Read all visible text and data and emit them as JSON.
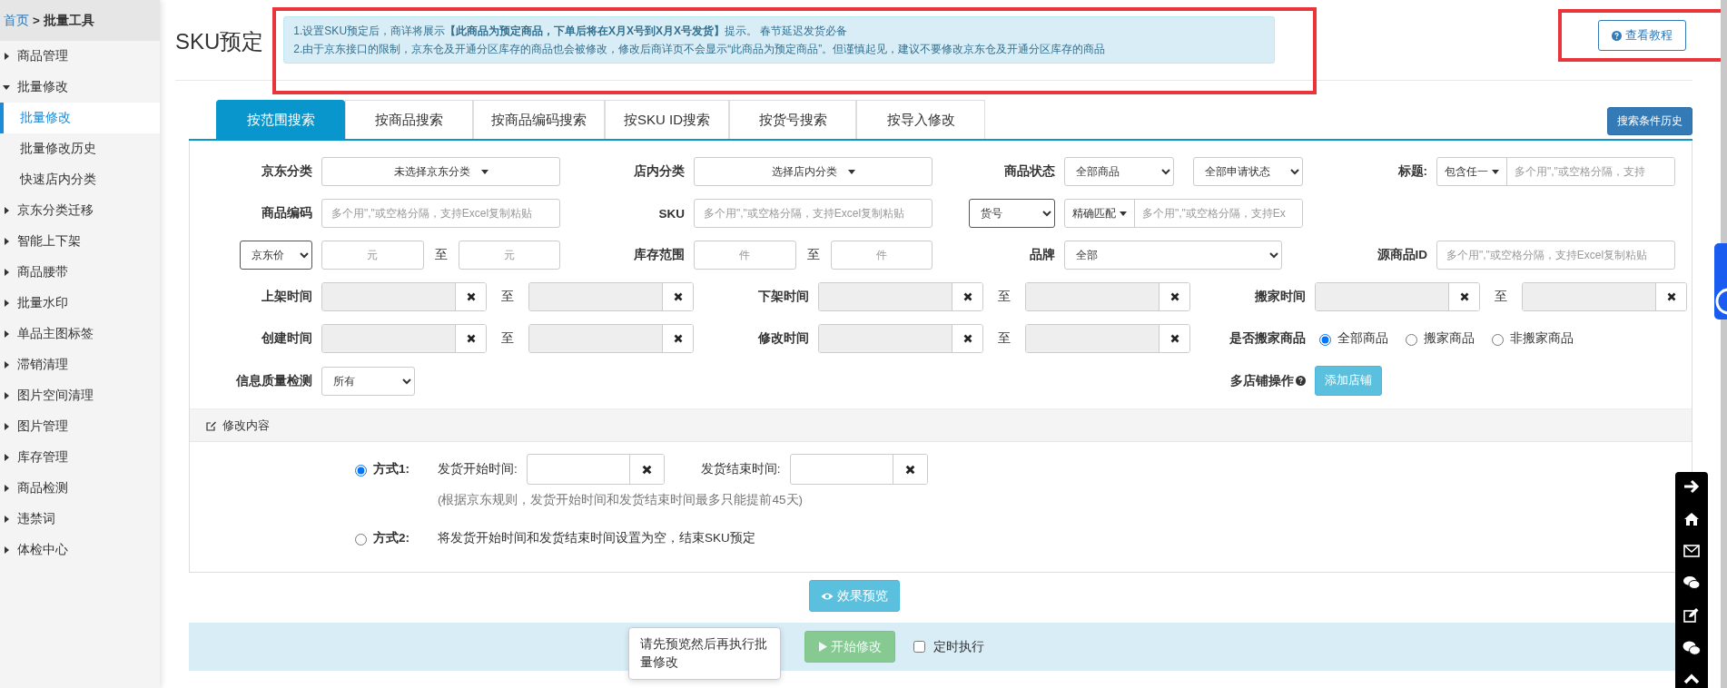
{
  "breadcrumb": {
    "home": "首页",
    "separator": ">",
    "current": "批量工具"
  },
  "sidebar": [
    {
      "label": "商品管理",
      "expanded": false
    },
    {
      "label": "批量修改",
      "expanded": true,
      "children": [
        {
          "label": "批量修改",
          "selected": true
        },
        {
          "label": "批量修改历史",
          "selected": false
        },
        {
          "label": "快速店内分类",
          "selected": false
        }
      ]
    },
    {
      "label": "京东分类迁移",
      "expanded": false
    },
    {
      "label": "智能上下架",
      "expanded": false
    },
    {
      "label": "商品腰带",
      "expanded": false
    },
    {
      "label": "批量水印",
      "expanded": false
    },
    {
      "label": "单品主图标签",
      "expanded": false
    },
    {
      "label": "滞销清理",
      "expanded": false
    },
    {
      "label": "图片空间清理",
      "expanded": false
    },
    {
      "label": "图片管理",
      "expanded": false
    },
    {
      "label": "库存管理",
      "expanded": false
    },
    {
      "label": "商品检测",
      "expanded": false
    },
    {
      "label": "违禁词",
      "expanded": false
    },
    {
      "label": "体检中心",
      "expanded": false
    }
  ],
  "page_title": "SKU预定",
  "notice": [
    "1.设置SKU预定后，商详将展示**【此商品为预定商品，下单后将在X月X号到X月X号发货】**提示。 春节延迟发货必备",
    "2.由于京东接口的限制，京东仓及开通分区库存的商品也会被修改，修改后商详页不会显示“此商品为预定商品”。但谨慎起见，建议不要修改京东仓及开通分区库存的商品"
  ],
  "tutorial_button": "查看教程",
  "tabs": [
    {
      "label": "按范围搜索",
      "selected": true
    },
    {
      "label": "按商品搜索",
      "selected": false
    },
    {
      "label": "按商品编码搜索",
      "selected": false
    },
    {
      "label": "按SKU ID搜索",
      "selected": false
    },
    {
      "label": "按货号搜索",
      "selected": false
    },
    {
      "label": "按导入修改",
      "selected": false
    }
  ],
  "history_button": "搜索条件历史",
  "filters": {
    "jd_category": {
      "label": "京东分类",
      "value": "未选择京东分类"
    },
    "shop_category": {
      "label": "店内分类",
      "value": "选择店内分类"
    },
    "status": {
      "label": "商品状态",
      "value": "全部商品"
    },
    "apply_status": {
      "value": "全部申请状态"
    },
    "title": {
      "label": "标题:",
      "match": "包含任一",
      "placeholder": "多个用\",\"或空格分隔，支持"
    },
    "product_code": {
      "label": "商品编码",
      "placeholder": "多个用\",\"或空格分隔，支持Excel复制粘贴"
    },
    "sku": {
      "label": "SKU",
      "placeholder": "多个用\",\"或空格分隔，支持Excel复制粘贴"
    },
    "item_no": {
      "field": "货号",
      "match": "精确匹配",
      "placeholder": "多个用\",\"或空格分隔，支持Ex"
    },
    "price": {
      "field": "京东价",
      "from_placeholder": "元",
      "separator": "至",
      "to_placeholder": "元"
    },
    "stock": {
      "label": "库存范围",
      "from_placeholder": "件",
      "separator": "至",
      "to_placeholder": "件"
    },
    "brand": {
      "label": "品牌",
      "value": "全部"
    },
    "source_id": {
      "label": "源商品ID",
      "placeholder": "多个用\",\"或空格分隔，支持Excel复制粘贴"
    },
    "dates": [
      {
        "label": "上架时间",
        "separator": "至"
      },
      {
        "label": "下架时间",
        "separator": "至"
      },
      {
        "label": "搬家时间",
        "separator": "至"
      },
      {
        "label": "创建时间",
        "separator": "至"
      },
      {
        "label": "修改时间",
        "separator": "至"
      }
    ],
    "moved": {
      "label": "是否搬家商品",
      "options": [
        {
          "label": "全部商品",
          "selected": true
        },
        {
          "label": "搬家商品",
          "selected": false
        },
        {
          "label": "非搬家商品",
          "selected": false
        }
      ]
    },
    "quality": {
      "label": "信息质量检测",
      "value": "所有"
    },
    "multi_shop": {
      "label": "多店铺操作",
      "button": "添加店铺"
    }
  },
  "edit": {
    "title": "修改内容",
    "methods": [
      {
        "kind": "dates",
        "label": "方式1:",
        "selected": true,
        "start_label": "发货开始时间:",
        "end_label": "发货结束时间:",
        "note": "(根据京东规则，发货开始时间和发货结束时间最多只能提前45天)"
      },
      {
        "kind": "text",
        "label": "方式2:",
        "selected": false,
        "text": "将发货开始时间和发货结束时间设置为空，结束SKU预定"
      }
    ]
  },
  "preview_button": "效果预览",
  "tooltip": "请先预览然后再执行批量修改",
  "start_button": {
    "label": "开始修改",
    "disabled": true
  },
  "schedule": {
    "label": "定时执行",
    "checked": false
  }
}
